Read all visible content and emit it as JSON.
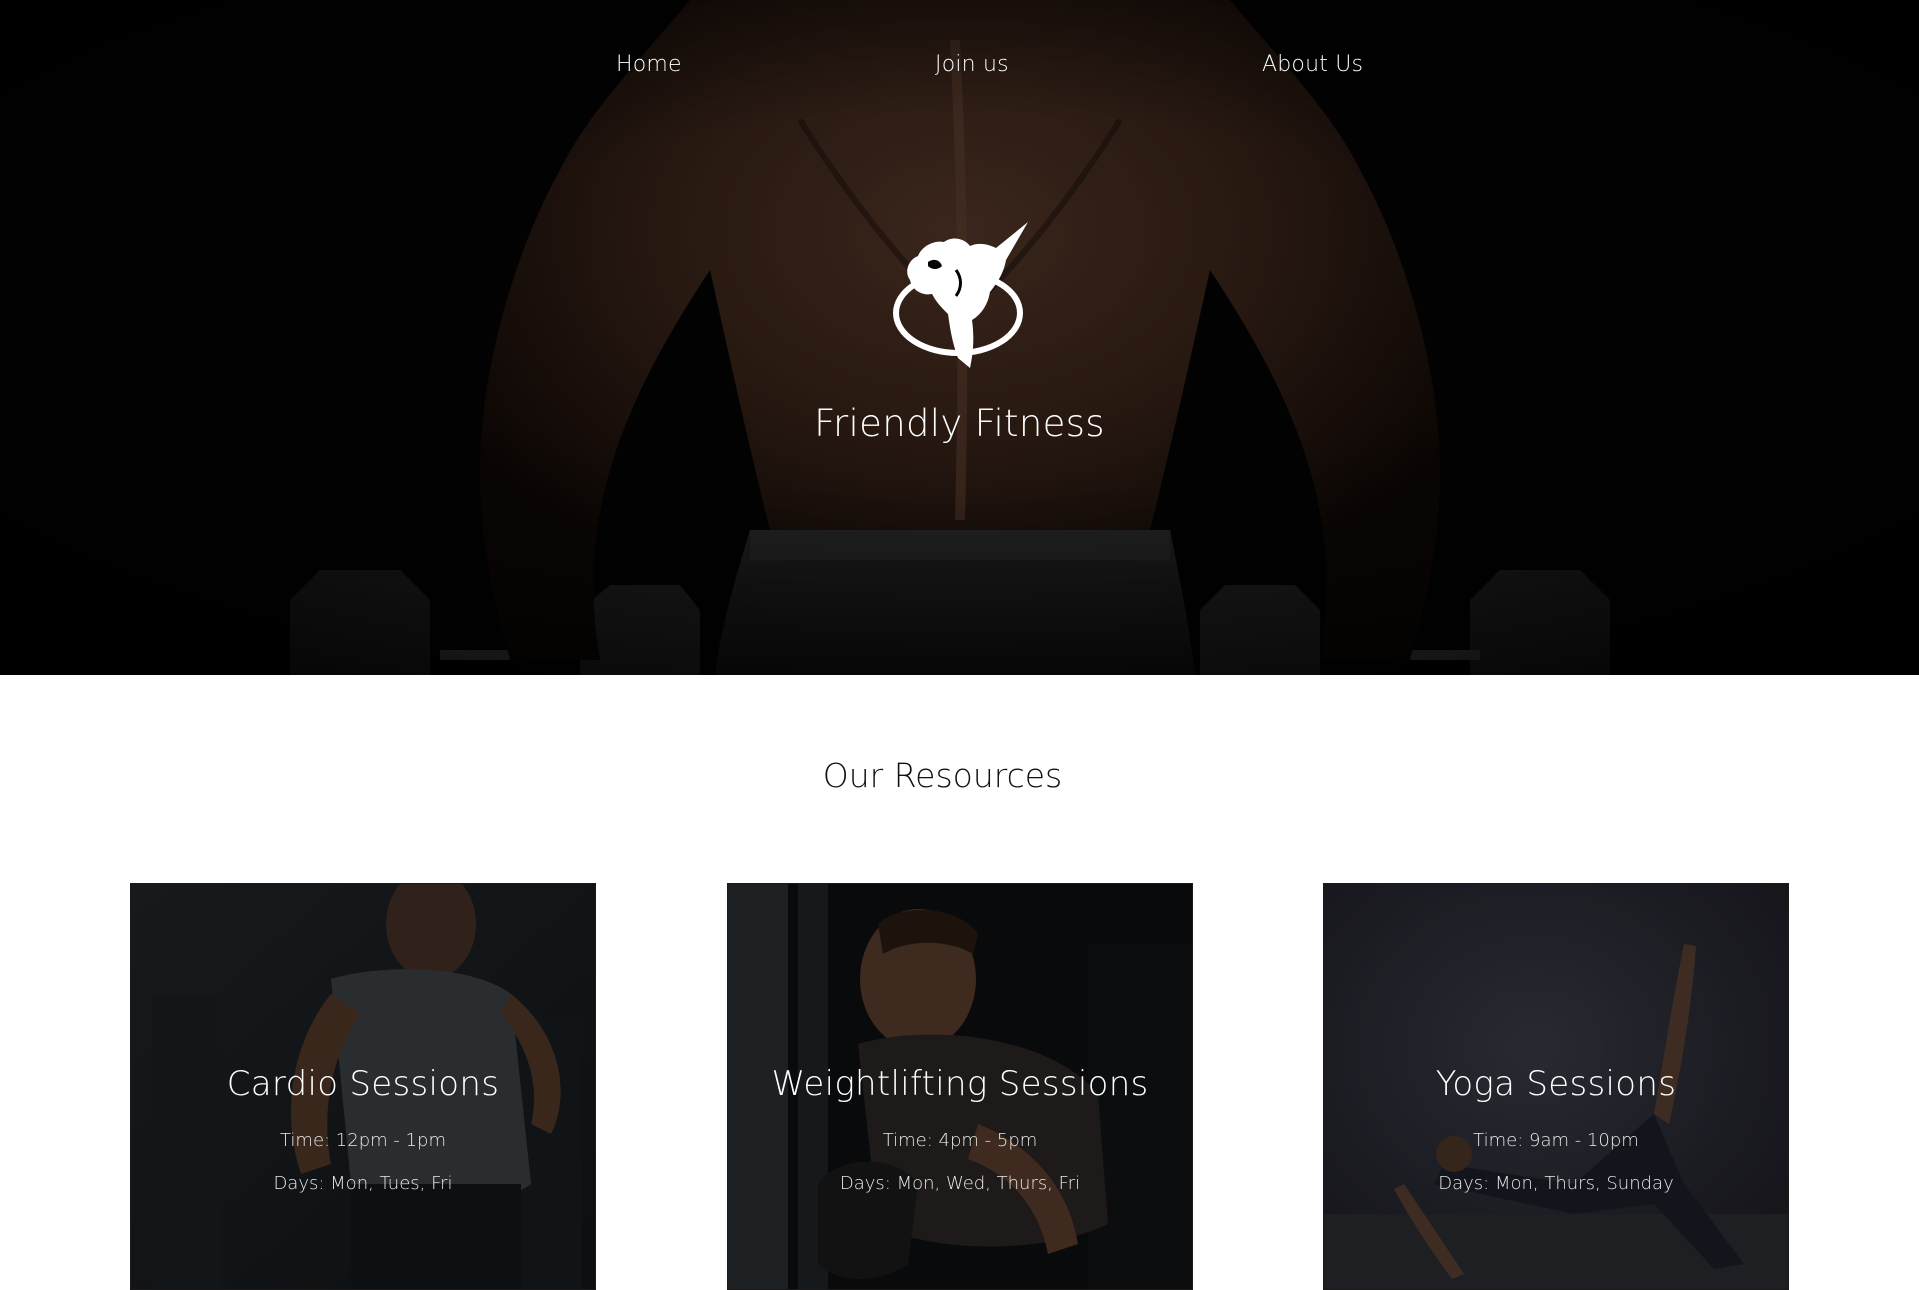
{
  "nav": {
    "home_label": "Home",
    "join_label": "Join us",
    "about_label": "About Us"
  },
  "hero": {
    "logo_icon": "bodybuilder-logo-icon",
    "title": "Friendly Fitness",
    "background": "muscular-back-with-dumbbells"
  },
  "resources": {
    "title": "Our Resources",
    "cards": [
      {
        "title": "Cardio Sessions",
        "time": "Time: 12pm - 1pm",
        "days": "Days: Mon, Tues, Fri",
        "image": "runner-photo"
      },
      {
        "title": "Weightlifting Sessions",
        "time": "Time: 4pm - 5pm",
        "days": "Days: Mon, Wed, Thurs, Fri",
        "image": "weightlifter-photo"
      },
      {
        "title": "Yoga Sessions",
        "time": "Time: 9am - 10pm",
        "days": "Days: Mon, Thurs, Sunday",
        "image": "yoga-pose-photo"
      }
    ]
  },
  "colors": {
    "hero_bg": "#050505",
    "text_light": "#ffffff",
    "text_dark": "#111111",
    "page_bg": "#ffffff"
  }
}
